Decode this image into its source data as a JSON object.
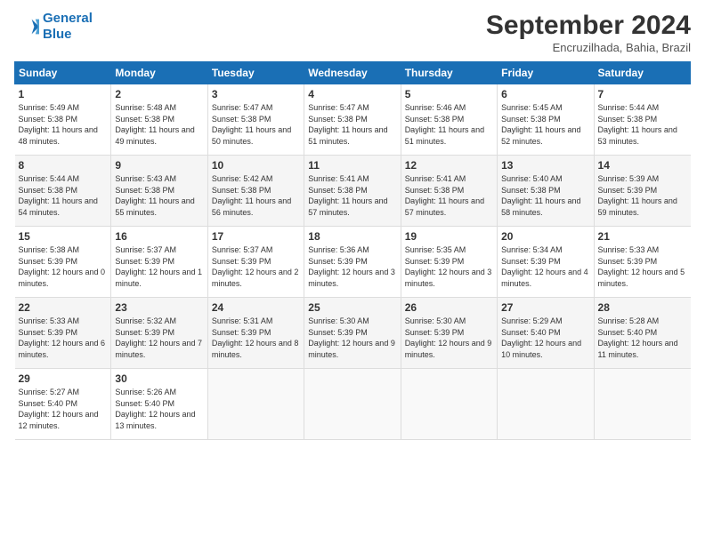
{
  "header": {
    "logo_line1": "General",
    "logo_line2": "Blue",
    "month_title": "September 2024",
    "location": "Encruzilhada, Bahia, Brazil"
  },
  "weekdays": [
    "Sunday",
    "Monday",
    "Tuesday",
    "Wednesday",
    "Thursday",
    "Friday",
    "Saturday"
  ],
  "weeks": [
    [
      {
        "day": "1",
        "sunrise": "5:49 AM",
        "sunset": "5:38 PM",
        "daylight": "11 hours and 48 minutes."
      },
      {
        "day": "2",
        "sunrise": "5:48 AM",
        "sunset": "5:38 PM",
        "daylight": "11 hours and 49 minutes."
      },
      {
        "day": "3",
        "sunrise": "5:47 AM",
        "sunset": "5:38 PM",
        "daylight": "11 hours and 50 minutes."
      },
      {
        "day": "4",
        "sunrise": "5:47 AM",
        "sunset": "5:38 PM",
        "daylight": "11 hours and 51 minutes."
      },
      {
        "day": "5",
        "sunrise": "5:46 AM",
        "sunset": "5:38 PM",
        "daylight": "11 hours and 51 minutes."
      },
      {
        "day": "6",
        "sunrise": "5:45 AM",
        "sunset": "5:38 PM",
        "daylight": "11 hours and 52 minutes."
      },
      {
        "day": "7",
        "sunrise": "5:44 AM",
        "sunset": "5:38 PM",
        "daylight": "11 hours and 53 minutes."
      }
    ],
    [
      {
        "day": "8",
        "sunrise": "5:44 AM",
        "sunset": "5:38 PM",
        "daylight": "11 hours and 54 minutes."
      },
      {
        "day": "9",
        "sunrise": "5:43 AM",
        "sunset": "5:38 PM",
        "daylight": "11 hours and 55 minutes."
      },
      {
        "day": "10",
        "sunrise": "5:42 AM",
        "sunset": "5:38 PM",
        "daylight": "11 hours and 56 minutes."
      },
      {
        "day": "11",
        "sunrise": "5:41 AM",
        "sunset": "5:38 PM",
        "daylight": "11 hours and 57 minutes."
      },
      {
        "day": "12",
        "sunrise": "5:41 AM",
        "sunset": "5:38 PM",
        "daylight": "11 hours and 57 minutes."
      },
      {
        "day": "13",
        "sunrise": "5:40 AM",
        "sunset": "5:38 PM",
        "daylight": "11 hours and 58 minutes."
      },
      {
        "day": "14",
        "sunrise": "5:39 AM",
        "sunset": "5:39 PM",
        "daylight": "11 hours and 59 minutes."
      }
    ],
    [
      {
        "day": "15",
        "sunrise": "5:38 AM",
        "sunset": "5:39 PM",
        "daylight": "12 hours and 0 minutes."
      },
      {
        "day": "16",
        "sunrise": "5:37 AM",
        "sunset": "5:39 PM",
        "daylight": "12 hours and 1 minute."
      },
      {
        "day": "17",
        "sunrise": "5:37 AM",
        "sunset": "5:39 PM",
        "daylight": "12 hours and 2 minutes."
      },
      {
        "day": "18",
        "sunrise": "5:36 AM",
        "sunset": "5:39 PM",
        "daylight": "12 hours and 3 minutes."
      },
      {
        "day": "19",
        "sunrise": "5:35 AM",
        "sunset": "5:39 PM",
        "daylight": "12 hours and 3 minutes."
      },
      {
        "day": "20",
        "sunrise": "5:34 AM",
        "sunset": "5:39 PM",
        "daylight": "12 hours and 4 minutes."
      },
      {
        "day": "21",
        "sunrise": "5:33 AM",
        "sunset": "5:39 PM",
        "daylight": "12 hours and 5 minutes."
      }
    ],
    [
      {
        "day": "22",
        "sunrise": "5:33 AM",
        "sunset": "5:39 PM",
        "daylight": "12 hours and 6 minutes."
      },
      {
        "day": "23",
        "sunrise": "5:32 AM",
        "sunset": "5:39 PM",
        "daylight": "12 hours and 7 minutes."
      },
      {
        "day": "24",
        "sunrise": "5:31 AM",
        "sunset": "5:39 PM",
        "daylight": "12 hours and 8 minutes."
      },
      {
        "day": "25",
        "sunrise": "5:30 AM",
        "sunset": "5:39 PM",
        "daylight": "12 hours and 9 minutes."
      },
      {
        "day": "26",
        "sunrise": "5:30 AM",
        "sunset": "5:39 PM",
        "daylight": "12 hours and 9 minutes."
      },
      {
        "day": "27",
        "sunrise": "5:29 AM",
        "sunset": "5:40 PM",
        "daylight": "12 hours and 10 minutes."
      },
      {
        "day": "28",
        "sunrise": "5:28 AM",
        "sunset": "5:40 PM",
        "daylight": "12 hours and 11 minutes."
      }
    ],
    [
      {
        "day": "29",
        "sunrise": "5:27 AM",
        "sunset": "5:40 PM",
        "daylight": "12 hours and 12 minutes."
      },
      {
        "day": "30",
        "sunrise": "5:26 AM",
        "sunset": "5:40 PM",
        "daylight": "12 hours and 13 minutes."
      },
      null,
      null,
      null,
      null,
      null
    ]
  ]
}
